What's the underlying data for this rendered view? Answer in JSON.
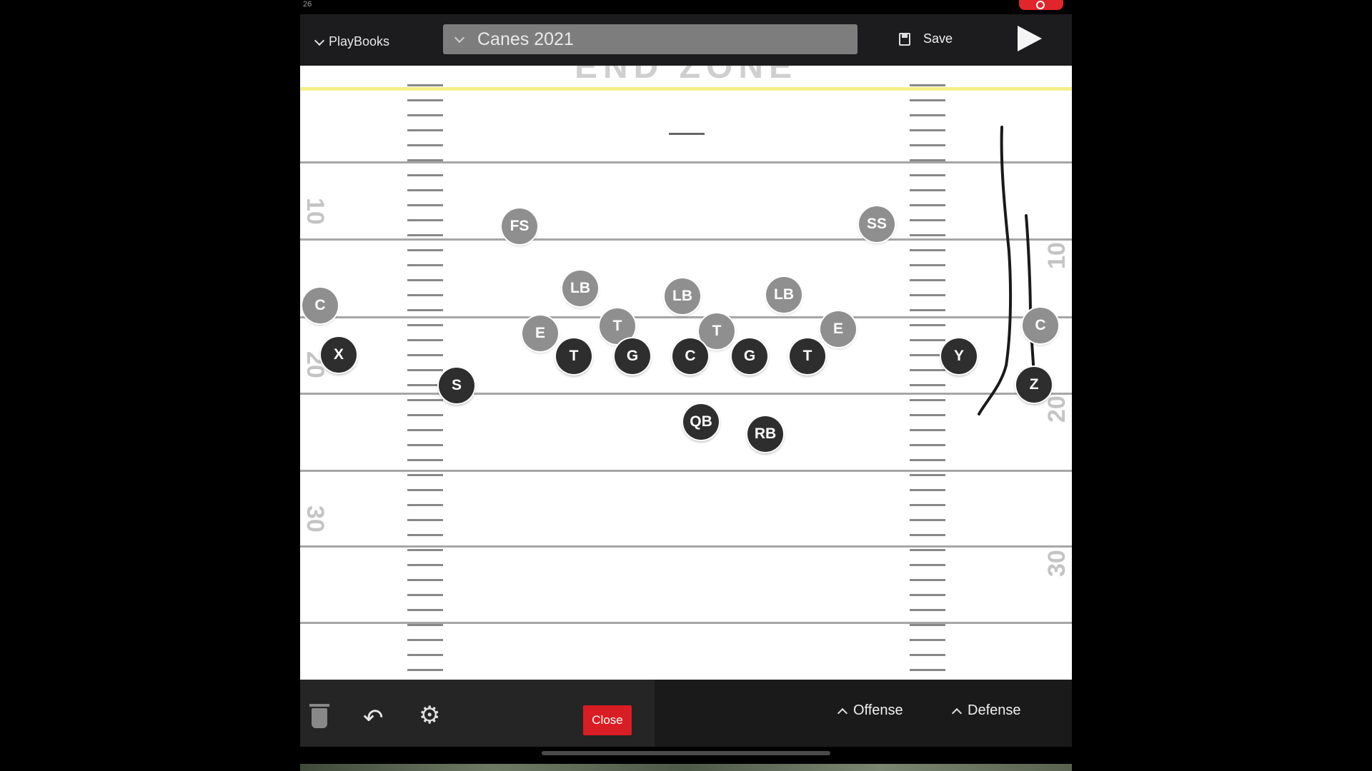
{
  "status": {
    "time": "26"
  },
  "header": {
    "playbooks_label": "PlayBooks",
    "playbook_name": "Canes 2021",
    "save_label": "Save"
  },
  "field": {
    "endzone_text": "END ZONE",
    "yard_numbers_left": [
      "10",
      "20",
      "30"
    ],
    "yard_numbers_right": [
      "10",
      "20",
      "30"
    ],
    "offense": {
      "X": "X",
      "S": "S",
      "LT": "T",
      "LG": "G",
      "C": "C",
      "RG": "G",
      "RT": "T",
      "Y": "Y",
      "Z": "Z",
      "QB": "QB",
      "RB": "RB"
    },
    "defense": {
      "FS": "FS",
      "SS": "SS",
      "LB1": "LB",
      "LB2": "LB",
      "LB3": "LB",
      "E1": "E",
      "DT1": "T",
      "DT2": "T",
      "E2": "E",
      "C1": "C",
      "C2": "C"
    }
  },
  "toolbar": {
    "close_label": "Close",
    "offense_label": "Offense",
    "defense_label": "Defense"
  },
  "colors": {
    "offense_player": "#2e2e2e",
    "defense_player": "#8f8f8f",
    "close_button": "#d91d24",
    "goal_line": "#f4f08a"
  }
}
